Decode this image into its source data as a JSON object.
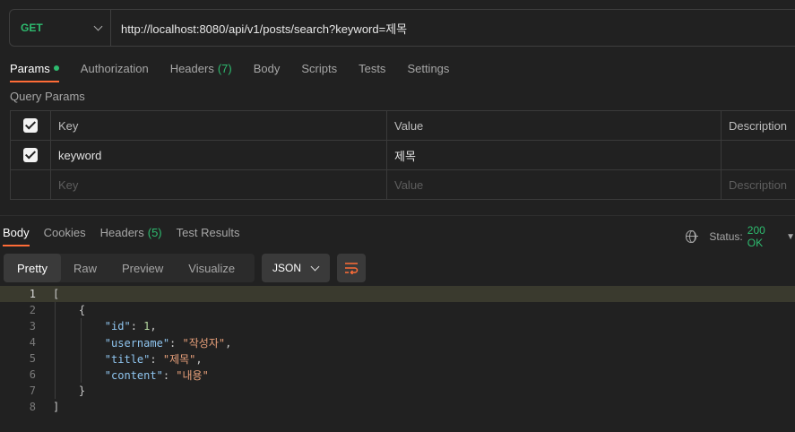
{
  "request": {
    "method": "GET",
    "url": "http://localhost:8080/api/v1/posts/search?keyword=제목"
  },
  "request_tabs": [
    {
      "label": "Params",
      "active": true,
      "dot": true
    },
    {
      "label": "Authorization"
    },
    {
      "label": "Headers",
      "count": "(7)"
    },
    {
      "label": "Body"
    },
    {
      "label": "Scripts"
    },
    {
      "label": "Tests"
    },
    {
      "label": "Settings"
    }
  ],
  "query_params": {
    "title": "Query Params",
    "headers": {
      "key": "Key",
      "value": "Value",
      "description": "Description"
    },
    "rows": [
      {
        "checked": true,
        "key": "keyword",
        "value": "제목",
        "description": ""
      }
    ],
    "placeholder": {
      "key": "Key",
      "value": "Value",
      "description": "Description"
    }
  },
  "response_tabs": [
    {
      "label": "Body",
      "active": true
    },
    {
      "label": "Cookies"
    },
    {
      "label": "Headers",
      "count": "(5)"
    },
    {
      "label": "Test Results"
    }
  ],
  "status": {
    "label": "Status:",
    "value": "200 OK"
  },
  "view_modes": [
    "Pretty",
    "Raw",
    "Preview",
    "Visualize"
  ],
  "format": "JSON",
  "code_lines": [
    {
      "n": "1",
      "text": "["
    },
    {
      "n": "2",
      "text": "    {"
    },
    {
      "n": "3",
      "text": "        \"id\": 1,"
    },
    {
      "n": "4",
      "text": "        \"username\": \"작성자\","
    },
    {
      "n": "5",
      "text": "        \"title\": \"제목\","
    },
    {
      "n": "6",
      "text": "        \"content\": \"내용\""
    },
    {
      "n": "7",
      "text": "    }"
    },
    {
      "n": "8",
      "text": "]"
    }
  ],
  "colors": {
    "accent": "#ff6c37",
    "success": "#2ebb6f",
    "background": "#212121"
  }
}
